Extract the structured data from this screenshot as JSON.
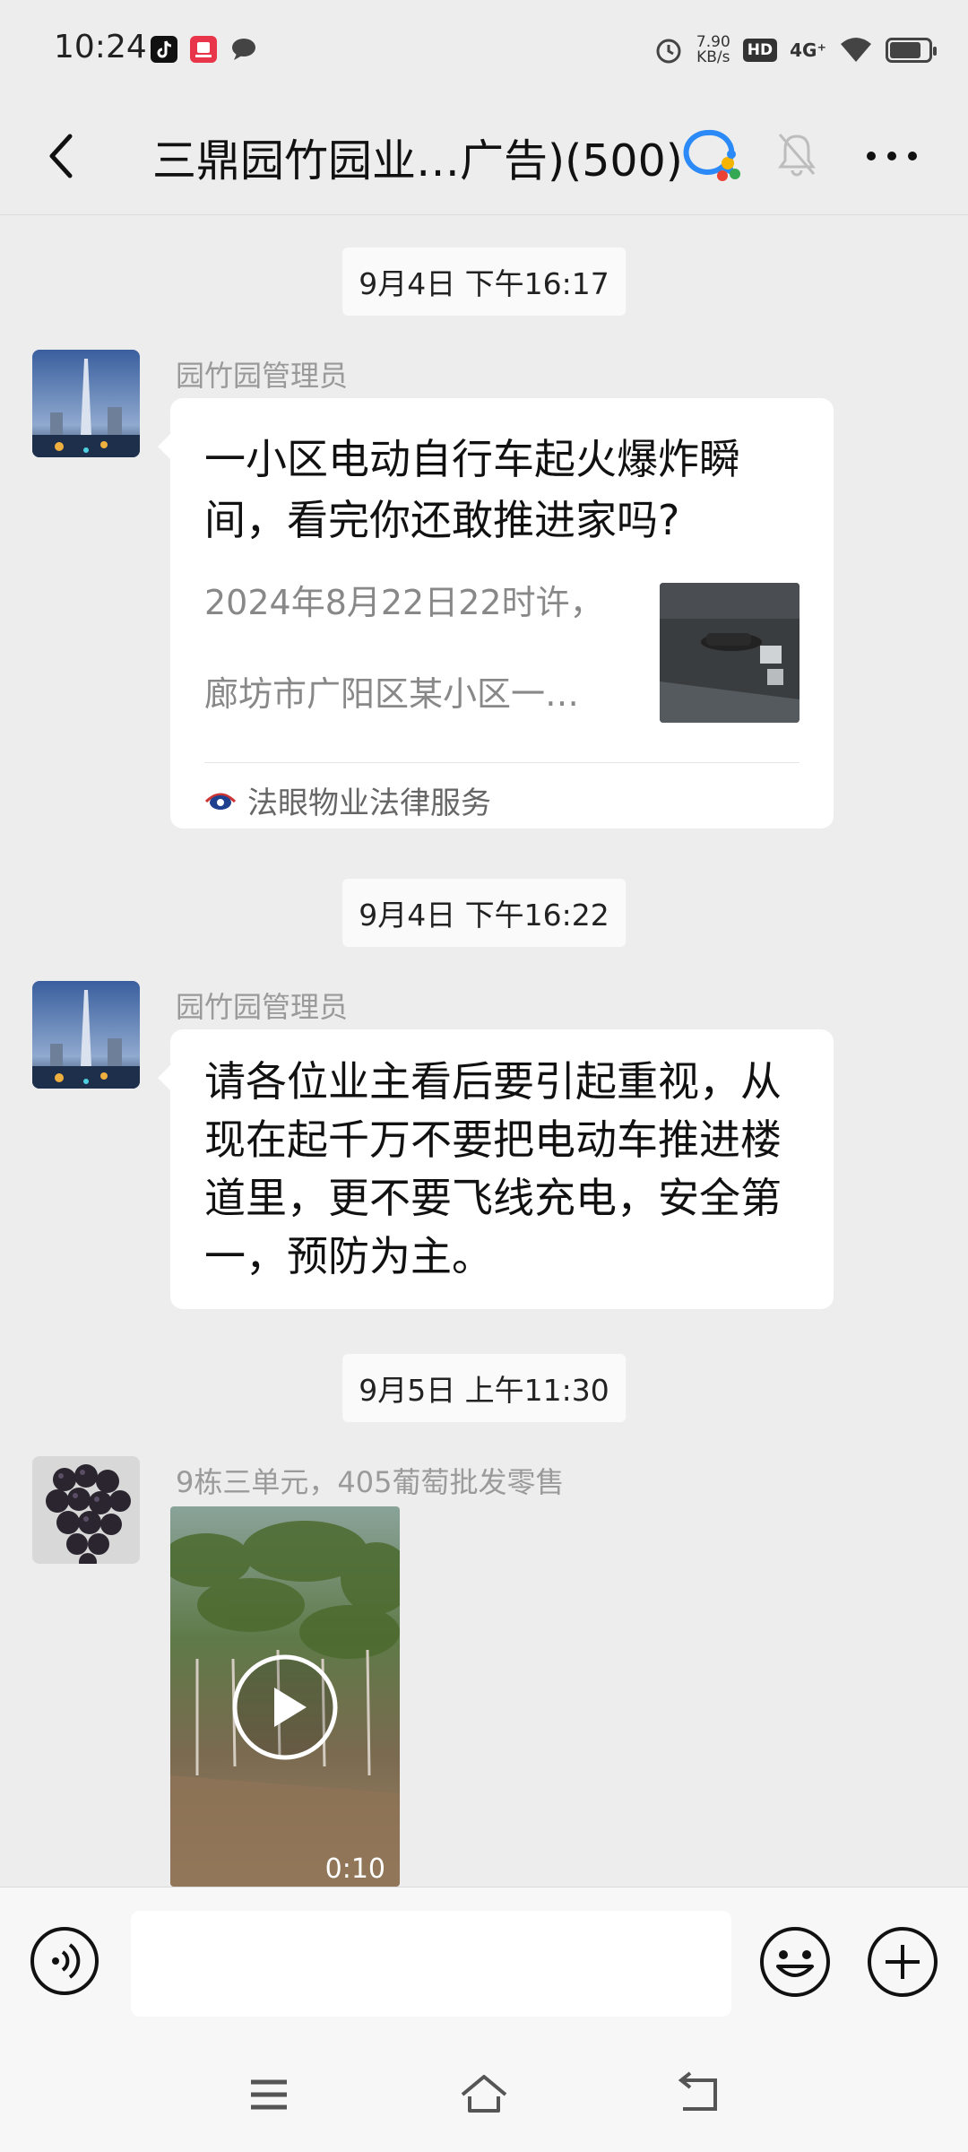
{
  "status_bar": {
    "time": "10:24",
    "net_speed_value": "7.90",
    "net_speed_unit": "KB/s",
    "hd_label": "HD",
    "network_label": "4G⁺",
    "battery_level_percent": 80,
    "icons": [
      "tiktok-icon",
      "app-icon",
      "message-icon",
      "alarm-icon",
      "wifi-icon",
      "battery-icon"
    ]
  },
  "header": {
    "title": "三鼎园竹园业…广告)(500)",
    "icons": [
      "back-icon",
      "group-chat-icon",
      "mute-bell-icon",
      "more-icon"
    ]
  },
  "messages": [
    {
      "timestamp": "9月4日 下午16:17",
      "sender": "园竹园管理员",
      "type": "link-card",
      "card_title": "一小区电动自行车起火爆炸瞬间，看完你还敢推进家吗?",
      "card_desc_line1": "2024年8月22日22时许，",
      "card_desc_line2": "廊坊市广阳区某小区一…",
      "card_source": "法眼物业法律服务"
    },
    {
      "timestamp": "9月4日 下午16:22",
      "sender": "园竹园管理员",
      "type": "text",
      "text": "请各位业主看后要引起重视，从现在起千万不要把电动车推进楼道里，更不要飞线充电，安全第一，预防为主。"
    },
    {
      "timestamp": "9月5日 上午11:30",
      "sender": "9栋三单元，405葡萄批发零售",
      "type": "video",
      "duration": "0:10"
    }
  ],
  "input_bar": {
    "placeholder": "",
    "icons": [
      "voice-icon",
      "emoji-icon",
      "plus-icon"
    ]
  },
  "nav_bar": {
    "icons": [
      "menu-icon",
      "home-icon",
      "back-nav-icon"
    ]
  },
  "colors": {
    "background": "#ededed",
    "bubble": "#ffffff",
    "timestamp_chip": "#fafafa",
    "sender_text": "#9a9a9a"
  }
}
